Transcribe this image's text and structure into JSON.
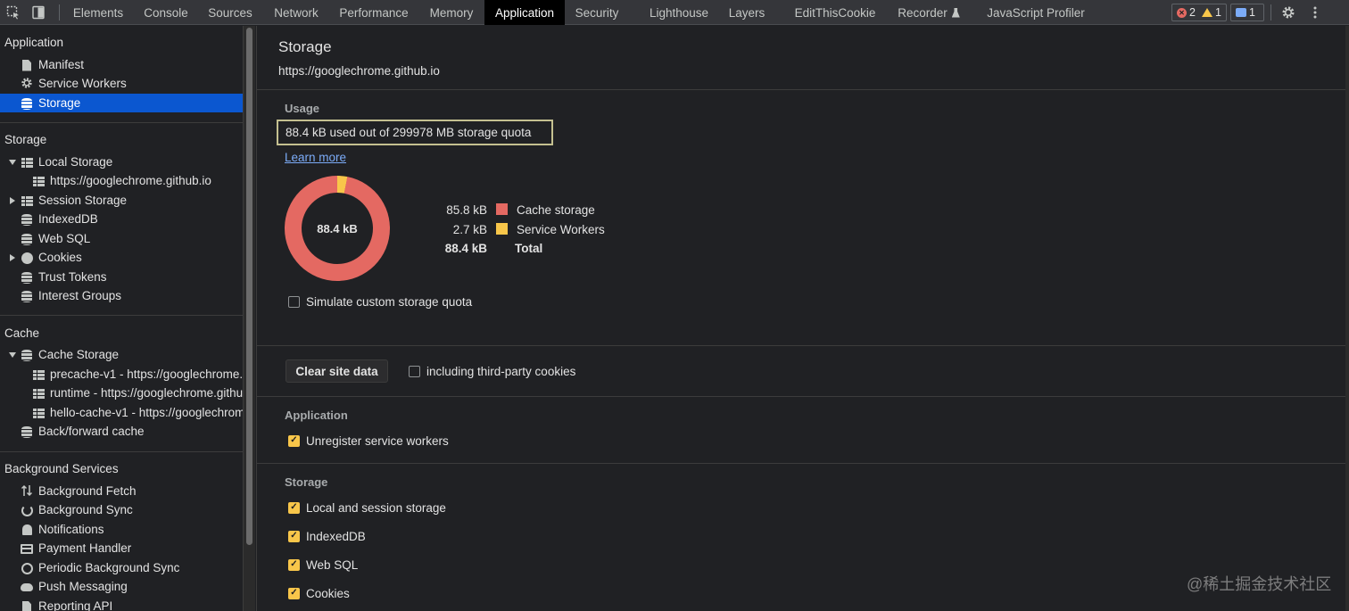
{
  "toolbar": {
    "tabs": [
      "Elements",
      "Console",
      "Sources",
      "Network",
      "Performance",
      "Memory",
      "Application",
      "Security",
      "Lighthouse",
      "Layers",
      "EditThisCookie",
      "Recorder",
      "JavaScript Profiler"
    ],
    "active_tab": "Application",
    "error_count": "2",
    "warning_count": "1",
    "message_count": "1"
  },
  "sidebar": {
    "sections": {
      "application": "Application",
      "storage": "Storage",
      "cache": "Cache",
      "background": "Background Services"
    },
    "application_items": [
      "Manifest",
      "Service Workers",
      "Storage"
    ],
    "storage_items": [
      "Local Storage",
      "https://googlechrome.github.io",
      "Session Storage",
      "IndexedDB",
      "Web SQL",
      "Cookies",
      "Trust Tokens",
      "Interest Groups"
    ],
    "cache_items": [
      "Cache Storage",
      "precache-v1 - https://googlechrome.g",
      "runtime - https://googlechrome.githut",
      "hello-cache-v1 - https://googlechrom",
      "Back/forward cache"
    ],
    "background_items": [
      "Background Fetch",
      "Background Sync",
      "Notifications",
      "Payment Handler",
      "Periodic Background Sync",
      "Push Messaging",
      "Reporting API"
    ]
  },
  "main": {
    "title": "Storage",
    "origin": "https://googlechrome.github.io",
    "usage_heading": "Usage",
    "usage_text": "88.4 kB used out of 299978 MB storage quota",
    "learn_more": "Learn more",
    "donut_total": "88.4 kB",
    "legend": [
      {
        "value": "85.8 kB",
        "name": "Cache storage",
        "color": "#e46962"
      },
      {
        "value": "2.7 kB",
        "name": "Service Workers",
        "color": "#f8c64a"
      },
      {
        "value": "88.4 kB",
        "name": "Total"
      }
    ],
    "simulate_quota": "Simulate custom storage quota",
    "clear_button": "Clear site data",
    "third_party": "including third-party cookies",
    "application_heading": "Application",
    "unregister_sw": "Unregister service workers",
    "storage_heading": "Storage",
    "storage_checks": [
      "Local and session storage",
      "IndexedDB",
      "Web SQL",
      "Cookies"
    ]
  },
  "watermark": "@稀土掘金技术社区",
  "colors": {
    "accent": "#0b57d0",
    "checkbox": "#f8c64a",
    "cache_storage": "#e46962",
    "service_workers": "#f8c64a"
  }
}
